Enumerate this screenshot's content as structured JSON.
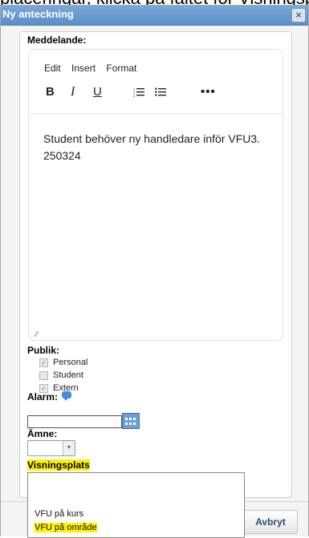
{
  "background_text": "placeringar, klicka på fältet för Visningsplats",
  "dialog": {
    "title": "Ny anteckning",
    "close_symbol": "×"
  },
  "message": {
    "label": "Meddelande:",
    "menu": [
      "Edit",
      "Insert",
      "Format"
    ],
    "toolbar": {
      "bold": "B",
      "italic": "I",
      "underline": "U",
      "numbered_list": "⁝☰",
      "bullet_list": "⁝☰",
      "more": "•••"
    },
    "text": "Student behöver ny handledare inför VFU3. 250324"
  },
  "publik": {
    "label": "Publik:",
    "options": [
      {
        "label": "Personal",
        "checked": true
      },
      {
        "label": "Student",
        "checked": false
      },
      {
        "label": "Extern",
        "checked": true
      }
    ]
  },
  "alarm": {
    "label": "Alarm:",
    "date_value": ""
  },
  "amne": {
    "label": "Ämne:",
    "selected": ""
  },
  "visningsplats": {
    "label": "Visningsplats",
    "options": [
      "",
      "VFU på kurs",
      "VFU på område"
    ],
    "highlighted": "VFU på område"
  },
  "footer": {
    "cancel_label": "Avbryt"
  },
  "colors": {
    "titlebar": "#5b8fc6",
    "highlight": "#fff200",
    "button_text": "#2b4d76"
  }
}
